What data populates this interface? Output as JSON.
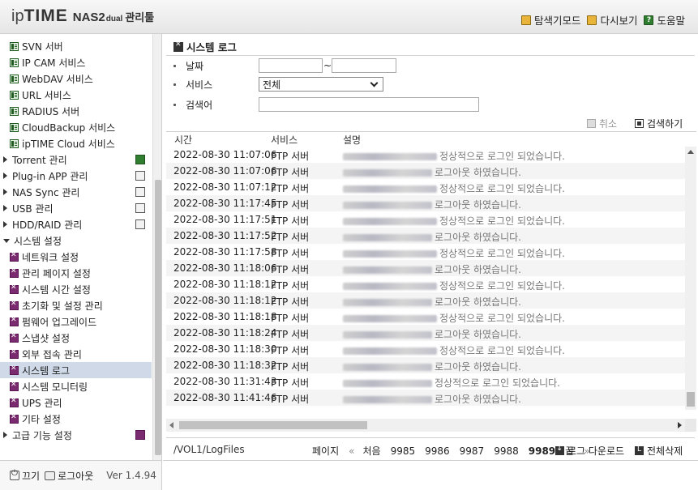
{
  "header": {
    "logo_ip": "ip",
    "logo_time": "TIME",
    "logo_model": "NAS2",
    "logo_dual": "dual",
    "logo_manager": "관리툴",
    "links": [
      {
        "label": "탐색기모드",
        "icon": "folder-icon"
      },
      {
        "label": "다시보기",
        "icon": "refresh-icon"
      },
      {
        "label": "도움말",
        "icon": "help-icon"
      }
    ],
    "help_glyph": "?"
  },
  "sidebar": {
    "services": [
      {
        "label": "SVN 서버"
      },
      {
        "label": "IP CAM 서비스"
      },
      {
        "label": "WebDAV 서비스"
      },
      {
        "label": "URL 서비스"
      },
      {
        "label": "RADIUS 서버"
      },
      {
        "label": "CloudBackup 서비스"
      },
      {
        "label": "ipTIME Cloud 서비스"
      }
    ],
    "categories": [
      {
        "label": "Torrent 관리"
      },
      {
        "label": "Plug-in APP 관리"
      },
      {
        "label": "NAS Sync 관리"
      },
      {
        "label": "USB 관리"
      },
      {
        "label": "HDD/RAID 관리"
      }
    ],
    "system_category": "시스템 설정",
    "system_items": [
      {
        "label": "네트워크 설정"
      },
      {
        "label": "관리 페이지 설정"
      },
      {
        "label": "시스템 시간 설정"
      },
      {
        "label": "초기화 및 설정 관리"
      },
      {
        "label": "펌웨어 업그레이드"
      },
      {
        "label": "스냅샷 설정"
      },
      {
        "label": "외부 접속 관리"
      },
      {
        "label": "시스템 로그"
      },
      {
        "label": "시스템 모니터링"
      },
      {
        "label": "UPS 관리"
      },
      {
        "label": "기타 설정"
      }
    ],
    "advanced_category": "고급 기능 설정",
    "selected": "시스템 로그",
    "bottom": {
      "off_label": "끄기",
      "logout_label": "로그아웃",
      "version": "Ver 1.4.94"
    }
  },
  "main": {
    "title": "시스템 로그",
    "filters": {
      "date_label": "날짜",
      "date_from": "",
      "date_to": "",
      "tilde": "~",
      "service_label": "서비스",
      "service_selected": "전체",
      "keyword_label": "검색어",
      "keyword_value": ""
    },
    "actions": {
      "cancel": "취소",
      "search": "검색하기"
    },
    "table": {
      "headers": [
        "시간",
        "서비스",
        "설명"
      ],
      "rows": [
        {
          "time": "2022-08-30 11:07:06",
          "service": "FTP 서버",
          "message": "정상적으로 로그인 되었습니다."
        },
        {
          "time": "2022-08-30 11:07:06",
          "service": "FTP 서버",
          "message": "로그아웃 하였습니다."
        },
        {
          "time": "2022-08-30 11:07:12",
          "service": "FTP 서버",
          "message": "정상적으로 로그인 되었습니다."
        },
        {
          "time": "2022-08-30 11:17:45",
          "service": "FTP 서버",
          "message": "로그아웃 하였습니다."
        },
        {
          "time": "2022-08-30 11:17:51",
          "service": "FTP 서버",
          "message": "정상적으로 로그인 되었습니다."
        },
        {
          "time": "2022-08-30 11:17:52",
          "service": "FTP 서버",
          "message": "로그아웃 하였습니다."
        },
        {
          "time": "2022-08-30 11:17:58",
          "service": "FTP 서버",
          "message": "정상적으로 로그인 되었습니다."
        },
        {
          "time": "2022-08-30 11:18:06",
          "service": "FTP 서버",
          "message": "로그아웃 하였습니다."
        },
        {
          "time": "2022-08-30 11:18:12",
          "service": "FTP 서버",
          "message": "정상적으로 로그인 되었습니다."
        },
        {
          "time": "2022-08-30 11:18:12",
          "service": "FTP 서버",
          "message": "로그아웃 하였습니다."
        },
        {
          "time": "2022-08-30 11:18:18",
          "service": "FTP 서버",
          "message": "정상적으로 로그인 되었습니다."
        },
        {
          "time": "2022-08-30 11:18:24",
          "service": "FTP 서버",
          "message": "로그아웃 하였습니다."
        },
        {
          "time": "2022-08-30 11:18:30",
          "service": "FTP 서버",
          "message": "정상적으로 로그인 되었습니다."
        },
        {
          "time": "2022-08-30 11:18:32",
          "service": "FTP 서버",
          "message": "로그아웃 하였습니다."
        },
        {
          "time": "2022-08-30 11:31:43",
          "service": "FTP 서버",
          "message": "정상적으로 로그인 되었습니다."
        },
        {
          "time": "2022-08-30 11:41:46",
          "service": "FTP 서버",
          "message": "로그아웃 하였습니다."
        }
      ]
    },
    "footer": {
      "path": "/VOL1/LogFiles",
      "page_label": "페이지",
      "prev": "«",
      "first": "처음",
      "pages": [
        "9985",
        "9986",
        "9987",
        "9988",
        "9989"
      ],
      "current_page": "9989",
      "last": "끝",
      "next": "»",
      "download": "로그 다운로드",
      "delete_all": "전체삭제"
    }
  }
}
